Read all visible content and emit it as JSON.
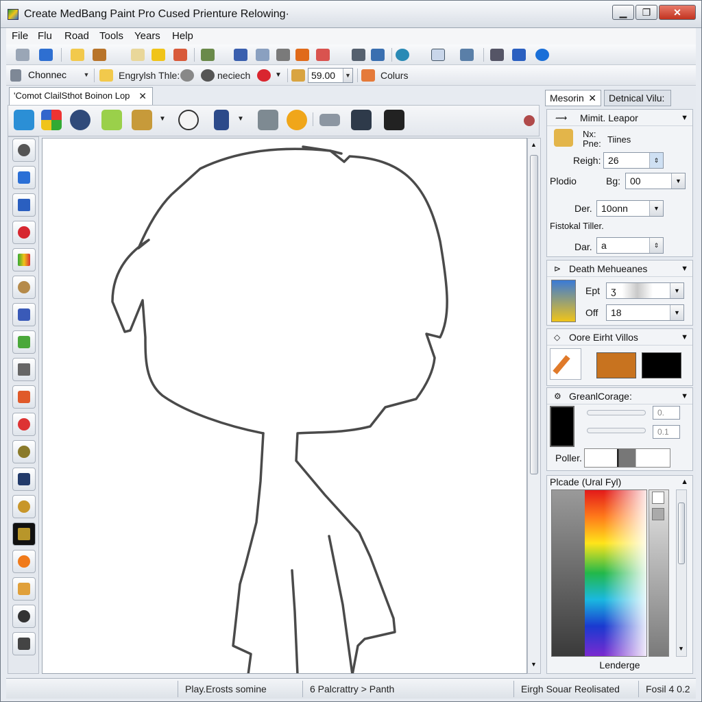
{
  "window": {
    "title": "Create MedBang Paint Pro Cused Prienture Relowing·",
    "min_label": "▁",
    "max_label": "❐",
    "close_label": "✕"
  },
  "menu": [
    "File",
    "Flu",
    "Road",
    "Tools",
    "Years",
    "Help"
  ],
  "toolbar2": {
    "channel_combo": "Chonnec",
    "engrylsh_label": "Engrylsh Thle:",
    "neciech_label": "neciech",
    "value_field": "59.00",
    "colours_label": "Colurs"
  },
  "document_tab": {
    "label": "'Comot ClailSthot Boinon Lop",
    "close": "✕"
  },
  "right_panel": {
    "tabs": [
      "Mesorin",
      "Detnical Vilu:"
    ],
    "tab_close": "✕",
    "brush_section": {
      "header": "Mimit. Leapor",
      "nx_label": "Nx:",
      "pne_label": "Pne:",
      "type_value": "Tiines",
      "reigh_label": "Reigh:",
      "reigh_value": "26",
      "plodio_label": "Plodio",
      "bg_label": "Bg:",
      "bg_value": "00",
      "der_label": "Der.",
      "der_value": "10onn",
      "fistokal_label": "Fistokal Tiller.",
      "dar_label": "Dar.",
      "dar_value": "a"
    },
    "depth_section": {
      "header": "Death Mehueanes",
      "ept_label": "Ept",
      "ept_value": "ʒ",
      "off_label": "Off",
      "off_value": "18"
    },
    "color_section": {
      "header": "Oore Eirht Villos",
      "swatch_primary": "#c8731f",
      "swatch_secondary": "#000000"
    },
    "general_section": {
      "header": "GreanlCorage:",
      "slider1_value": "0.",
      "slider2_value": "0.1",
      "poller_label": "Poller."
    },
    "palette_section": {
      "header": "Plcade (Ural Fyl)",
      "footer": "Lenderge"
    }
  },
  "status": {
    "cell1": "Play.Erosts somine",
    "cell2": "6 Palcrattry  >  Panth",
    "cell3": "Eirgh Souar Reolisated",
    "cell4": "Fosil  4  0.2"
  }
}
